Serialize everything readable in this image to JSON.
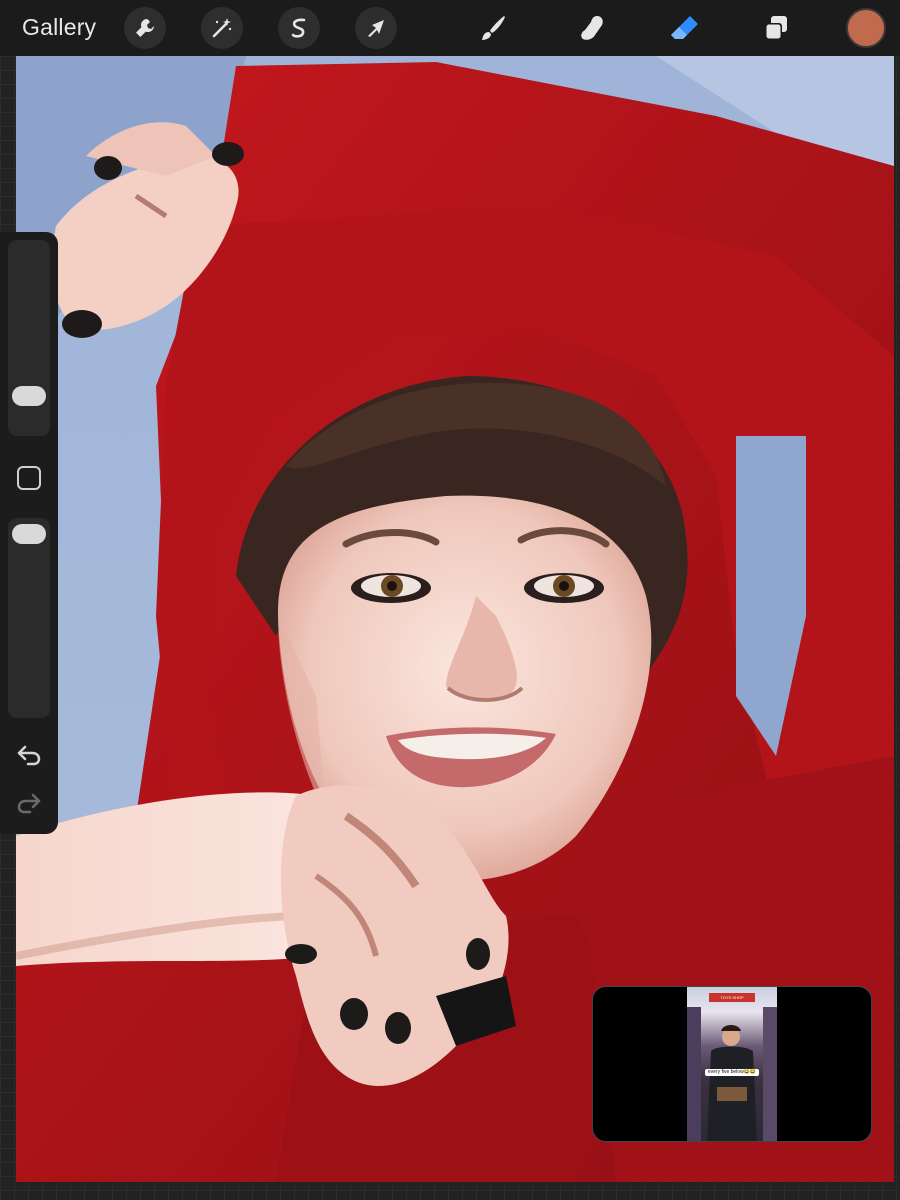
{
  "toolbar": {
    "gallery_label": "Gallery",
    "tools": [
      {
        "name": "actions",
        "icon": "wrench-icon"
      },
      {
        "name": "adjustments",
        "icon": "magic-wand-icon"
      },
      {
        "name": "selection",
        "icon": "selection-s-icon"
      },
      {
        "name": "transform",
        "icon": "arrow-cursor-icon"
      },
      {
        "name": "brush",
        "icon": "brush-icon"
      },
      {
        "name": "smudge",
        "icon": "smudge-finger-icon"
      },
      {
        "name": "eraser",
        "icon": "eraser-icon",
        "active": true
      },
      {
        "name": "layers",
        "icon": "layers-icon"
      }
    ],
    "current_color": "#c06a4e",
    "accent_color": "#2f8cff"
  },
  "sidebar": {
    "brush_size_icon": "size-slider-icon",
    "opacity_icon": "opacity-slider-icon",
    "modify_icon": "square-modify-icon",
    "undo_icon": "undo-icon",
    "redo_icon": "redo-icon"
  },
  "pip": {
    "caption": "every five below😂😂",
    "store_sign": "TOYS SHOP"
  }
}
